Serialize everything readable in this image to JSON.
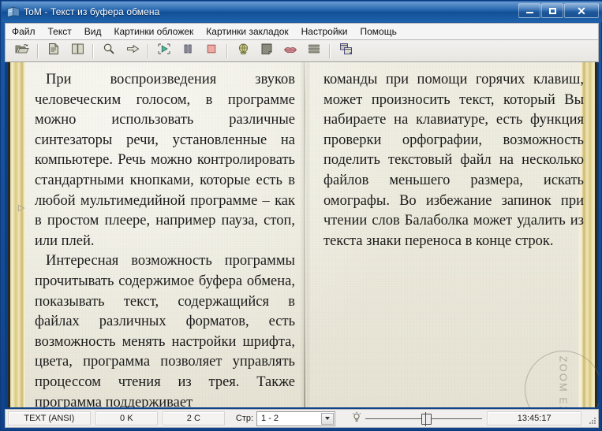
{
  "window": {
    "title": "ToM - Текст из буфера обмена",
    "icon": "book-icon",
    "buttons": {
      "minimize": "minimize-icon",
      "maximize": "maximize-icon",
      "close": "close-icon"
    }
  },
  "menu": {
    "items": [
      {
        "label": "Файл"
      },
      {
        "label": "Текст"
      },
      {
        "label": "Вид"
      },
      {
        "label": "Картинки обложек"
      },
      {
        "label": "Картинки закладок"
      },
      {
        "label": "Настройки"
      },
      {
        "label": "Помощь"
      }
    ]
  },
  "toolbar": {
    "groups": [
      {
        "buttons": [
          {
            "name": "open-folder-icon"
          }
        ]
      },
      {
        "buttons": [
          {
            "name": "document-icon"
          },
          {
            "name": "book-open-icon"
          }
        ]
      },
      {
        "buttons": [
          {
            "name": "search-icon"
          },
          {
            "name": "goto-arrow-icon"
          }
        ]
      },
      {
        "buttons": [
          {
            "name": "play-icon"
          },
          {
            "name": "pause-icon"
          },
          {
            "name": "stop-icon"
          }
        ]
      },
      {
        "buttons": [
          {
            "name": "globe-icon"
          },
          {
            "name": "bookmark-page-icon"
          },
          {
            "name": "lips-icon"
          },
          {
            "name": "lines-icon"
          }
        ]
      },
      {
        "buttons": [
          {
            "name": "split-window-icon"
          }
        ]
      }
    ]
  },
  "book": {
    "left_page": {
      "paragraphs": [
        "При воспроизведения звуков человеческим голосом, в программе можно использовать различные синтезаторы речи, установленные на компьютере. Речь можно контролировать стандартными кнопками, которые есть в любой мультимедийной программе – как в простом плеере, например пауза, стоп, или плей.",
        "Интересная возможность программы прочитывать содержимое буфера обмена, показывать текст, содержащийся в файлах различных форматов, есть возможность менять настройки шрифта, цвета, программа позволяет управлять процессом чтения из трея. Также программа поддерживает"
      ]
    },
    "right_page": {
      "paragraphs": [
        "команды при помощи горячих клавиш, может произносить текст, который Вы набираете на клавиатуре, есть функция проверки орфографии, возможность поделить текстовый файл на несколько файлов меньшего размера, искать омографы. Во избежание запинок при чтении слов Балаболка может удалить из текста знаки переноса в конце строк."
      ]
    },
    "bookmark_marker": "▷",
    "watermark": "ZOOM EXE"
  },
  "statusbar": {
    "encoding": "TEXT (ANSI)",
    "size": "0 K",
    "chars": "2 C",
    "page_label": "Стр:",
    "page_value": "1 - 2",
    "page_options": [
      "1 - 2"
    ],
    "brightness_icon": "lightbulb-icon",
    "clock": "13:45:17",
    "grip": "resize-grip-icon"
  },
  "colors": {
    "titlebar": "#1d5ea8",
    "window_frame": "#0c3e86",
    "paper": "#eceadc",
    "page_edge_gold": "#d9c87e",
    "text": "#1b1b1b",
    "menu_bg": "#f5f5f5"
  }
}
